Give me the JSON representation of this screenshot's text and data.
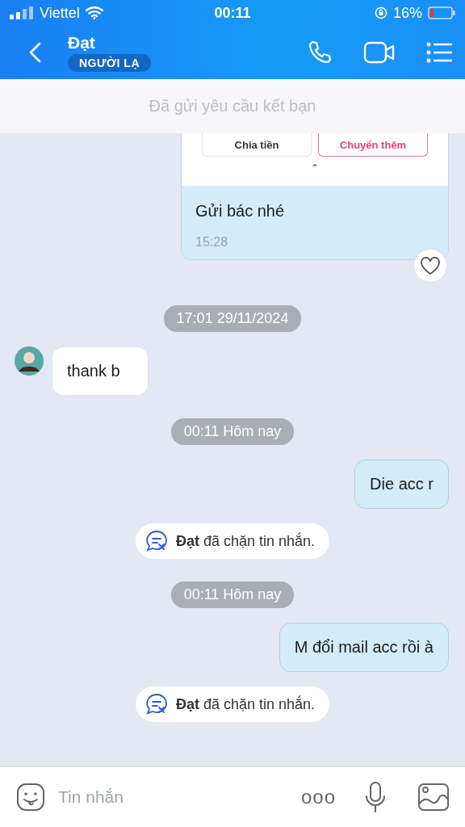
{
  "status_bar": {
    "carrier": "Viettel",
    "time": "00:11",
    "battery": "16%"
  },
  "header": {
    "name": "Đạt",
    "badge": "NGƯỜI LẠ"
  },
  "banner": "Đã gửi yêu cầu kết bạn",
  "messages": [
    {
      "kind": "card",
      "buttons": [
        {
          "label": "Chia tiền",
          "kind": "plain"
        },
        {
          "label": "Chuyển thêm",
          "kind": "accent"
        }
      ],
      "caret": "ˆ",
      "text": "Gửi bác nhé",
      "time": "15:28",
      "liked": false
    },
    {
      "kind": "timestamp",
      "text": "17:01 29/11/2024"
    },
    {
      "kind": "received",
      "text": "thank b"
    },
    {
      "kind": "timestamp",
      "text": "00:11 Hôm nay"
    },
    {
      "kind": "sent",
      "text": "Die acc r"
    },
    {
      "kind": "system",
      "text": "**Đạt** đã chặn tin nhắn."
    },
    {
      "kind": "timestamp",
      "text": "00:11 Hôm nay"
    },
    {
      "kind": "sent",
      "text": "M đổi mail acc rồi à"
    },
    {
      "kind": "system",
      "text": "**Đạt** đã chặn tin nhắn."
    }
  ],
  "composer": {
    "placeholder": "Tin nhắn",
    "more": "ooo"
  }
}
